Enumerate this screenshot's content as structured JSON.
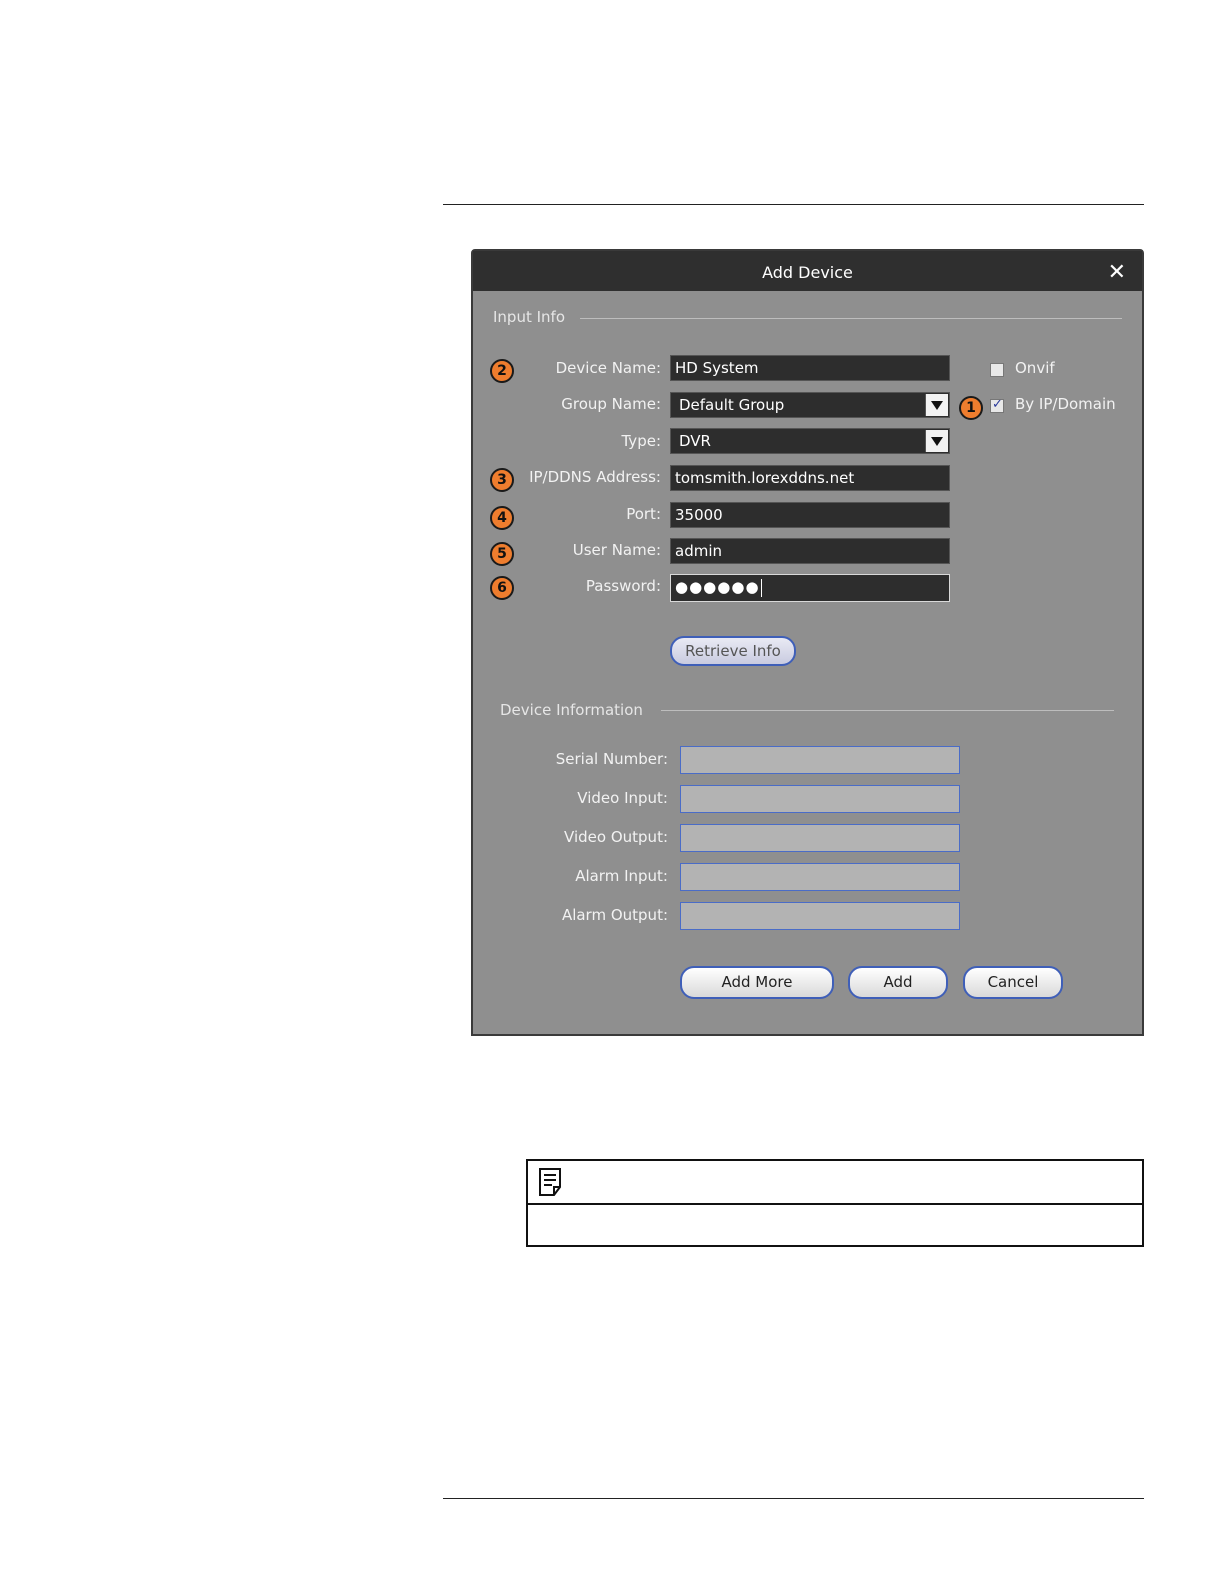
{
  "dialog": {
    "title": "Add Device",
    "close_glyph": "✕",
    "input_info_title": "Input Info",
    "device_info_title": "Device Information"
  },
  "form": {
    "device_name_label": "Device Name:",
    "device_name_value": "HD System",
    "group_name_label": "Group Name:",
    "group_name_value": "Default Group",
    "type_label": "Type:",
    "type_value": "DVR",
    "ip_label": "IP/DDNS Address:",
    "ip_value": "tomsmith.lorexddns.net",
    "port_label": "Port:",
    "port_value": "35000",
    "user_label": "User Name:",
    "user_value": "admin",
    "password_label": "Password:",
    "password_value": "●●●●●●"
  },
  "options": {
    "onvif_label": "Onvif",
    "onvif_checked": false,
    "by_ip_label": "By IP/Domain",
    "by_ip_checked": true
  },
  "buttons": {
    "retrieve": "Retrieve Info",
    "add_more": "Add More",
    "add": "Add",
    "cancel": "Cancel"
  },
  "device_info": {
    "serial_label": "Serial Number:",
    "video_input_label": "Video Input:",
    "video_output_label": "Video Output:",
    "alarm_input_label": "Alarm Input:",
    "alarm_output_label": "Alarm Output:"
  },
  "callouts": {
    "c1": "1",
    "c2": "2",
    "c3": "3",
    "c4": "4",
    "c5": "5",
    "c6": "6"
  },
  "colors": {
    "callout": "#ee7d2e",
    "titlebar": "#2f2f2f",
    "dialog_bg": "#8f8f8f"
  }
}
